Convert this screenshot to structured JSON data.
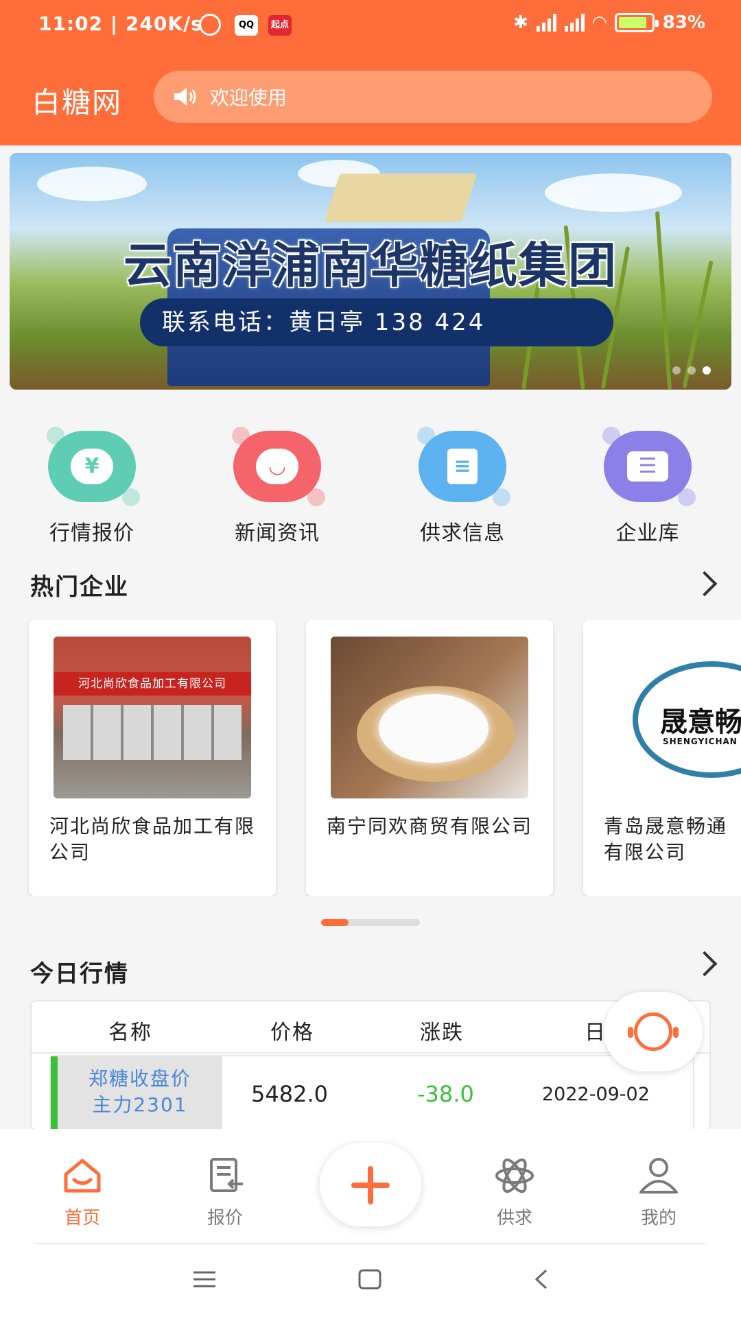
{
  "status_bar": {
    "time": "11:02",
    "speed": "240K/s",
    "battery": "83%",
    "qq_label": "QQ",
    "qidian_label": "起点"
  },
  "header": {
    "brand": "白糖网",
    "notice": "欢迎使用"
  },
  "banner": {
    "title": "云南洋浦南华糖纸集团",
    "phone": "联系电话：黄日亭 138      424"
  },
  "quick_links": [
    {
      "label": "行情报价",
      "icon": "yen-icon",
      "color": "#5fcdb3"
    },
    {
      "label": "新闻资讯",
      "icon": "chat-icon",
      "color": "#f4646a"
    },
    {
      "label": "供求信息",
      "icon": "document-icon",
      "color": "#5cb3f0"
    },
    {
      "label": "企业库",
      "icon": "id-card-icon",
      "color": "#8b7fe8"
    }
  ],
  "hot_companies": {
    "title": "热门企业",
    "items": [
      {
        "name": "河北尚欣食品加工有限公司",
        "sign": "河北尚欣食品加工有限公司"
      },
      {
        "name": "南宁同欢商贸有限公司"
      },
      {
        "name": "青岛晟意畅通有限公司",
        "logo_text": "晟意畅",
        "logo_sub": "SHENGYICHAN"
      }
    ]
  },
  "market": {
    "title": "今日行情",
    "headers": [
      "名称",
      "价格",
      "涨跌",
      "日"
    ],
    "rows": [
      {
        "name_line1": "郑糖收盘价",
        "name_line2": "主力2301",
        "price": "5482.0",
        "change": "-38.0",
        "date": "2022-09-02"
      }
    ]
  },
  "bottom_nav": {
    "tabs": [
      "首页",
      "报价",
      "供求",
      "我的"
    ]
  },
  "colors": {
    "brand": "#ff6d3a",
    "down": "#3bbf3b",
    "link": "#4a86d8"
  }
}
